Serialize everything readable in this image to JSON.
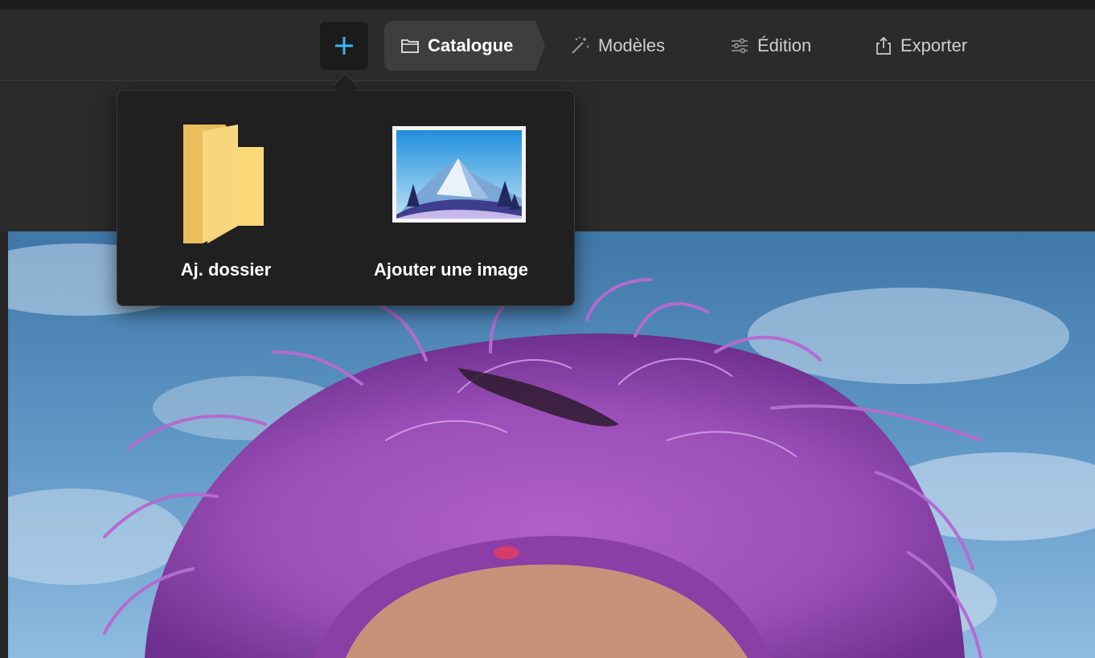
{
  "toolbar": {
    "add_icon": "plus-icon",
    "accent": "#3db4f2",
    "tabs": [
      {
        "label": "Catalogue",
        "icon": "folder-outline-icon",
        "active": true
      },
      {
        "label": "Modèles",
        "icon": "magic-wand-icon",
        "active": false
      },
      {
        "label": "Édition",
        "icon": "sliders-icon",
        "active": false
      },
      {
        "label": "Exporter",
        "icon": "share-export-icon",
        "active": false
      }
    ]
  },
  "add_menu": {
    "items": [
      {
        "label": "Aj. dossier",
        "icon": "folder-icon"
      },
      {
        "label": "Ajouter une image",
        "icon": "image-mountain-icon"
      }
    ]
  },
  "canvas": {
    "photo_subject": "purple-hair-sky-photo"
  }
}
